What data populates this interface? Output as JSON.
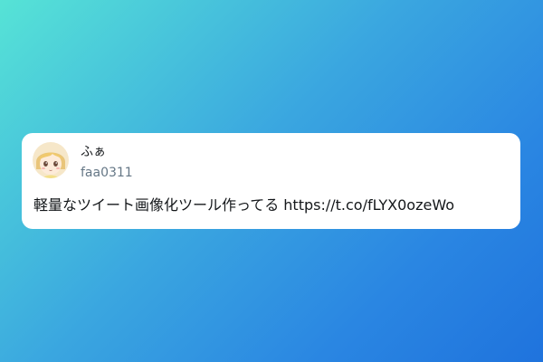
{
  "tweet": {
    "display_name": "ふぁ",
    "handle": "faa0311",
    "text": "軽量なツイート画像化ツール作ってる https://t.co/fLYX0ozeWo",
    "avatar_icon": "user-avatar-anime-face"
  },
  "colors": {
    "gradient_start": "#56e3d6",
    "gradient_end": "#1f73dd",
    "card_background": "#ffffff",
    "handle_text": "#657786",
    "body_text": "#14171a"
  }
}
